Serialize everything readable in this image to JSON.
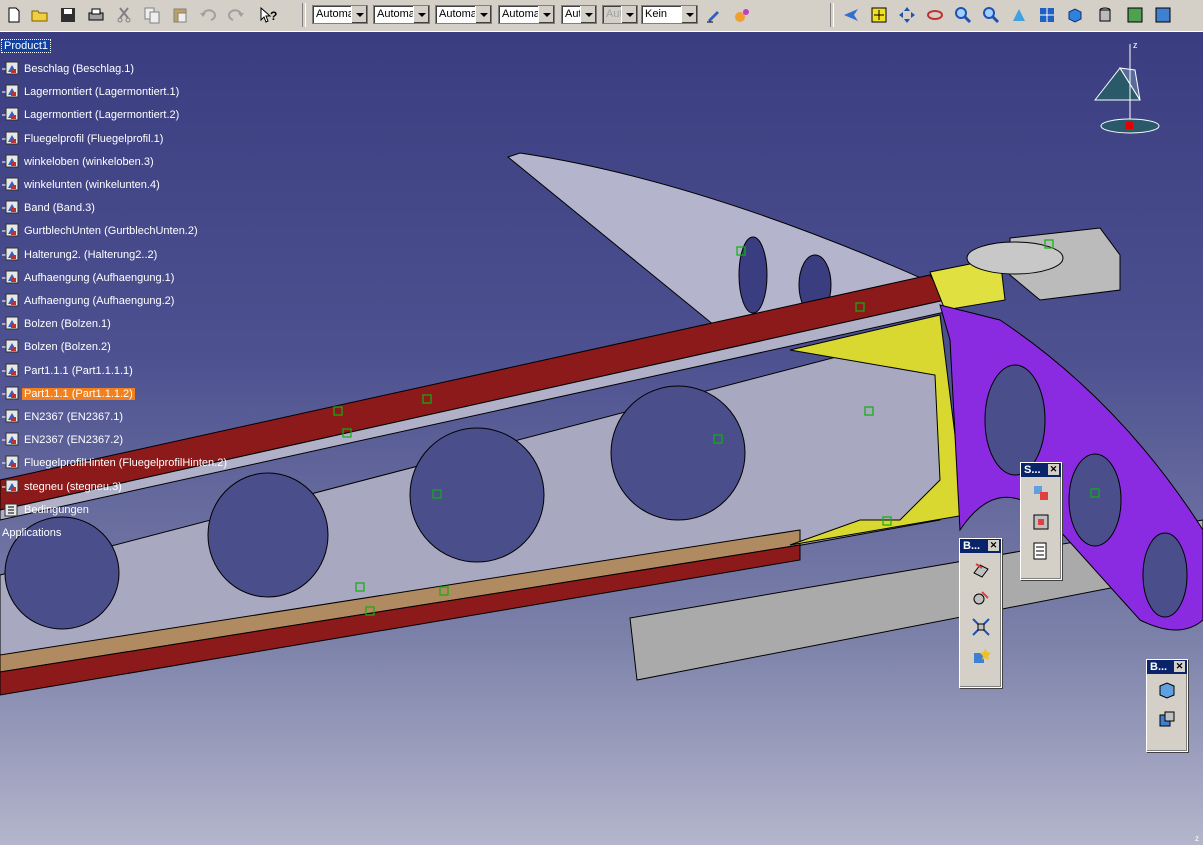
{
  "toolbar": {
    "left_icons": [
      "new-file-icon",
      "open-folder-icon",
      "save-icon",
      "print-icon",
      "cut-icon",
      "copy-icon",
      "paste-icon",
      "undo-icon",
      "redo-icon",
      "whats-this-icon"
    ],
    "combos": [
      {
        "value": "Automa",
        "disabled": false
      },
      {
        "value": "Automa",
        "disabled": false
      },
      {
        "value": "Automa",
        "disabled": false
      },
      {
        "value": "Automa",
        "disabled": false
      },
      {
        "value": "Aut",
        "disabled": false
      },
      {
        "value": "Aut",
        "disabled": true
      },
      {
        "value": "Kein",
        "disabled": false
      }
    ],
    "right_icons": [
      "fly-mode-icon",
      "fit-all-icon",
      "pan-icon",
      "rotate-icon",
      "zoom-in-icon",
      "zoom-out-icon",
      "normal-view-icon",
      "multi-view-icon",
      "iso-view-icon",
      "shading-icon",
      "hide-show-icon",
      "swap-space-icon"
    ]
  },
  "tree": {
    "root": "Product1",
    "items": [
      {
        "label": "Beschlag (Beschlag.1)",
        "selected": false
      },
      {
        "label": "Lagermontiert (Lagermontiert.1)",
        "selected": false
      },
      {
        "label": "Lagermontiert (Lagermontiert.2)",
        "selected": false
      },
      {
        "label": "Fluegelprofil (Fluegelprofil.1)",
        "selected": false
      },
      {
        "label": "winkeloben (winkeloben.3)",
        "selected": false
      },
      {
        "label": "winkelunten (winkelunten.4)",
        "selected": false
      },
      {
        "label": "Band (Band.3)",
        "selected": false
      },
      {
        "label": "GurtblechUnten (GurtblechUnten.2)",
        "selected": false
      },
      {
        "label": "Halterung2. (Halterung2..2)",
        "selected": false
      },
      {
        "label": "Aufhaengung (Aufhaengung.1)",
        "selected": false
      },
      {
        "label": "Aufhaengung (Aufhaengung.2)",
        "selected": false
      },
      {
        "label": "Bolzen (Bolzen.1)",
        "selected": false
      },
      {
        "label": "Bolzen (Bolzen.2)",
        "selected": false
      },
      {
        "label": "Part1.1.1 (Part1.1.1.1)",
        "selected": false
      },
      {
        "label": "Part1.1.1 (Part1.1.1.2)",
        "selected": true
      },
      {
        "label": "EN2367 (EN2367.1)",
        "selected": false
      },
      {
        "label": "EN2367 (EN2367.2)",
        "selected": false
      },
      {
        "label": "FluegelprofilHinten (FluegelprofilHinten.2)",
        "selected": false
      },
      {
        "label": "stegneu (stegneu.3)",
        "selected": false
      }
    ],
    "constraints": "Bedingungen",
    "applications": "Applications"
  },
  "palettes": [
    {
      "title": "S...",
      "icons": [
        "constraint-icon",
        "fix-icon",
        "catalog-icon"
      ]
    },
    {
      "title": "B...",
      "icons": [
        "manipulate-icon",
        "snap-icon",
        "explode-icon",
        "stop-manipulate-icon"
      ]
    },
    {
      "title": "B...",
      "icons": [
        "bom-icon",
        "scene-icon"
      ]
    }
  ],
  "colors": {
    "selected": "#f08020",
    "root_selected": "#1040a0",
    "titlebar": "#0a246a",
    "wing_purple": "#8a2be2",
    "yellow_part": "#d8d830",
    "red_flange": "#8c1a1a"
  },
  "compass_label": "z"
}
